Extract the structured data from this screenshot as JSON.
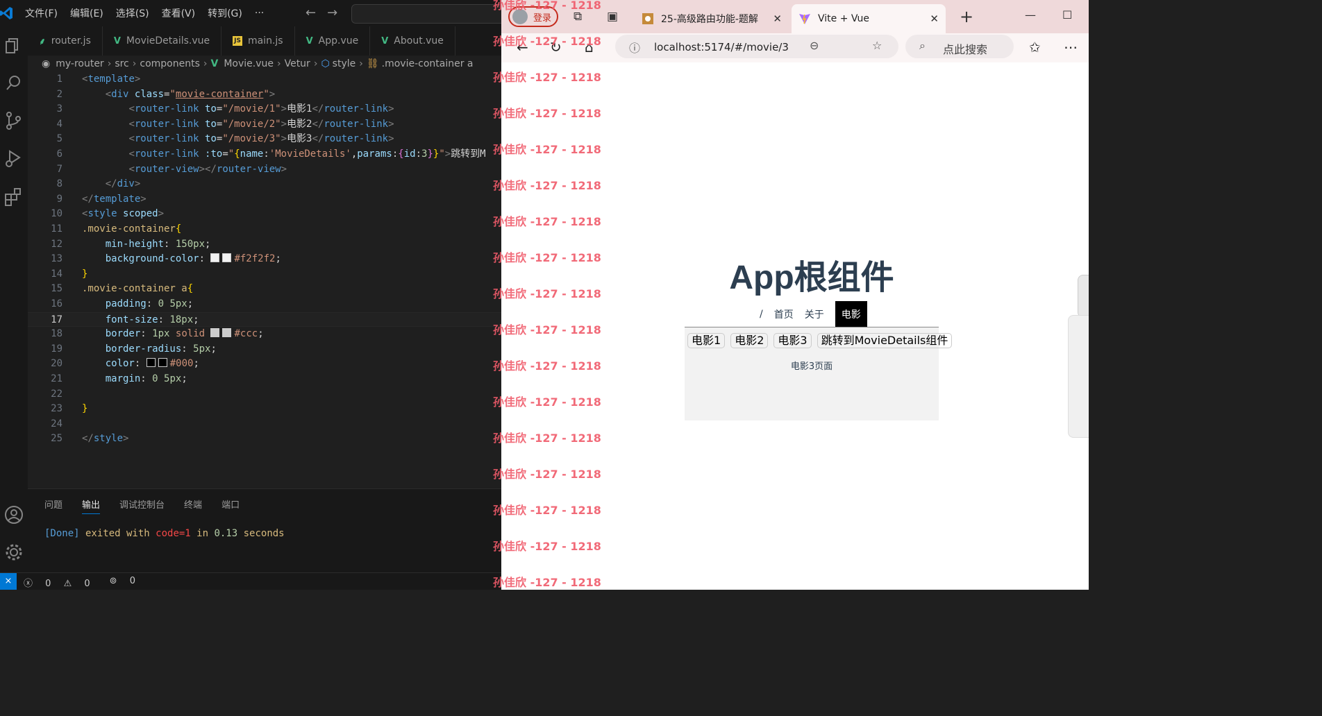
{
  "vscode": {
    "menu": [
      "文件(F)",
      "编辑(E)",
      "选择(S)",
      "查看(V)",
      "转到(G)",
      "···"
    ],
    "tabs": [
      {
        "label": "router.js",
        "icon": "js-leaf-icon"
      },
      {
        "label": "MovieDetails.vue",
        "icon": "vue-icon"
      },
      {
        "label": "main.js",
        "icon": "js-icon"
      },
      {
        "label": "App.vue",
        "icon": "vue-icon"
      },
      {
        "label": "About.vue",
        "icon": "vue-icon"
      }
    ],
    "breadcrumb": [
      "my-router",
      "src",
      "components",
      "Movie.vue",
      "Vetur",
      "style",
      ".movie-container a"
    ],
    "code_lines": [
      "1",
      "2",
      "3",
      "4",
      "5",
      "6",
      "7",
      "8",
      "9",
      "10",
      "11",
      "12",
      "13",
      "14",
      "15",
      "16",
      "17",
      "18",
      "19",
      "20",
      "21",
      "22",
      "23",
      "24",
      "25"
    ],
    "current_line": 17,
    "panel_tabs": [
      "问题",
      "输出",
      "调试控制台",
      "终端",
      "端口"
    ],
    "active_panel_tab": "输出",
    "output": {
      "done": "[Done]",
      "msg": " exited with ",
      "code": "code=1",
      "in": " in ",
      "time": "0.13",
      "sec": " seconds"
    },
    "status": {
      "errors": "0",
      "warnings": "0",
      "ports": "0"
    }
  },
  "browser": {
    "profile_label": "登录",
    "tabs": [
      {
        "title": "25-高级路由功能-题解"
      },
      {
        "title": "Vite + Vue"
      }
    ],
    "url": "localhost:5174/#/movie/3",
    "search_placeholder": "点此搜索",
    "page": {
      "title": "App根组件",
      "nav": [
        "/",
        "首页",
        "关于",
        "电影"
      ],
      "movie_links": [
        "电影1",
        "电影2",
        "电影3",
        "跳转到MovieDetails组件"
      ],
      "movie_page_text": "电影3页面"
    }
  },
  "watermark": "孙佳欣 -127 - 1218",
  "colors": {
    "accent": "#0078d4",
    "watermark": "#f05a6a",
    "vue_green": "#42b883",
    "title": "#2c3e50"
  }
}
